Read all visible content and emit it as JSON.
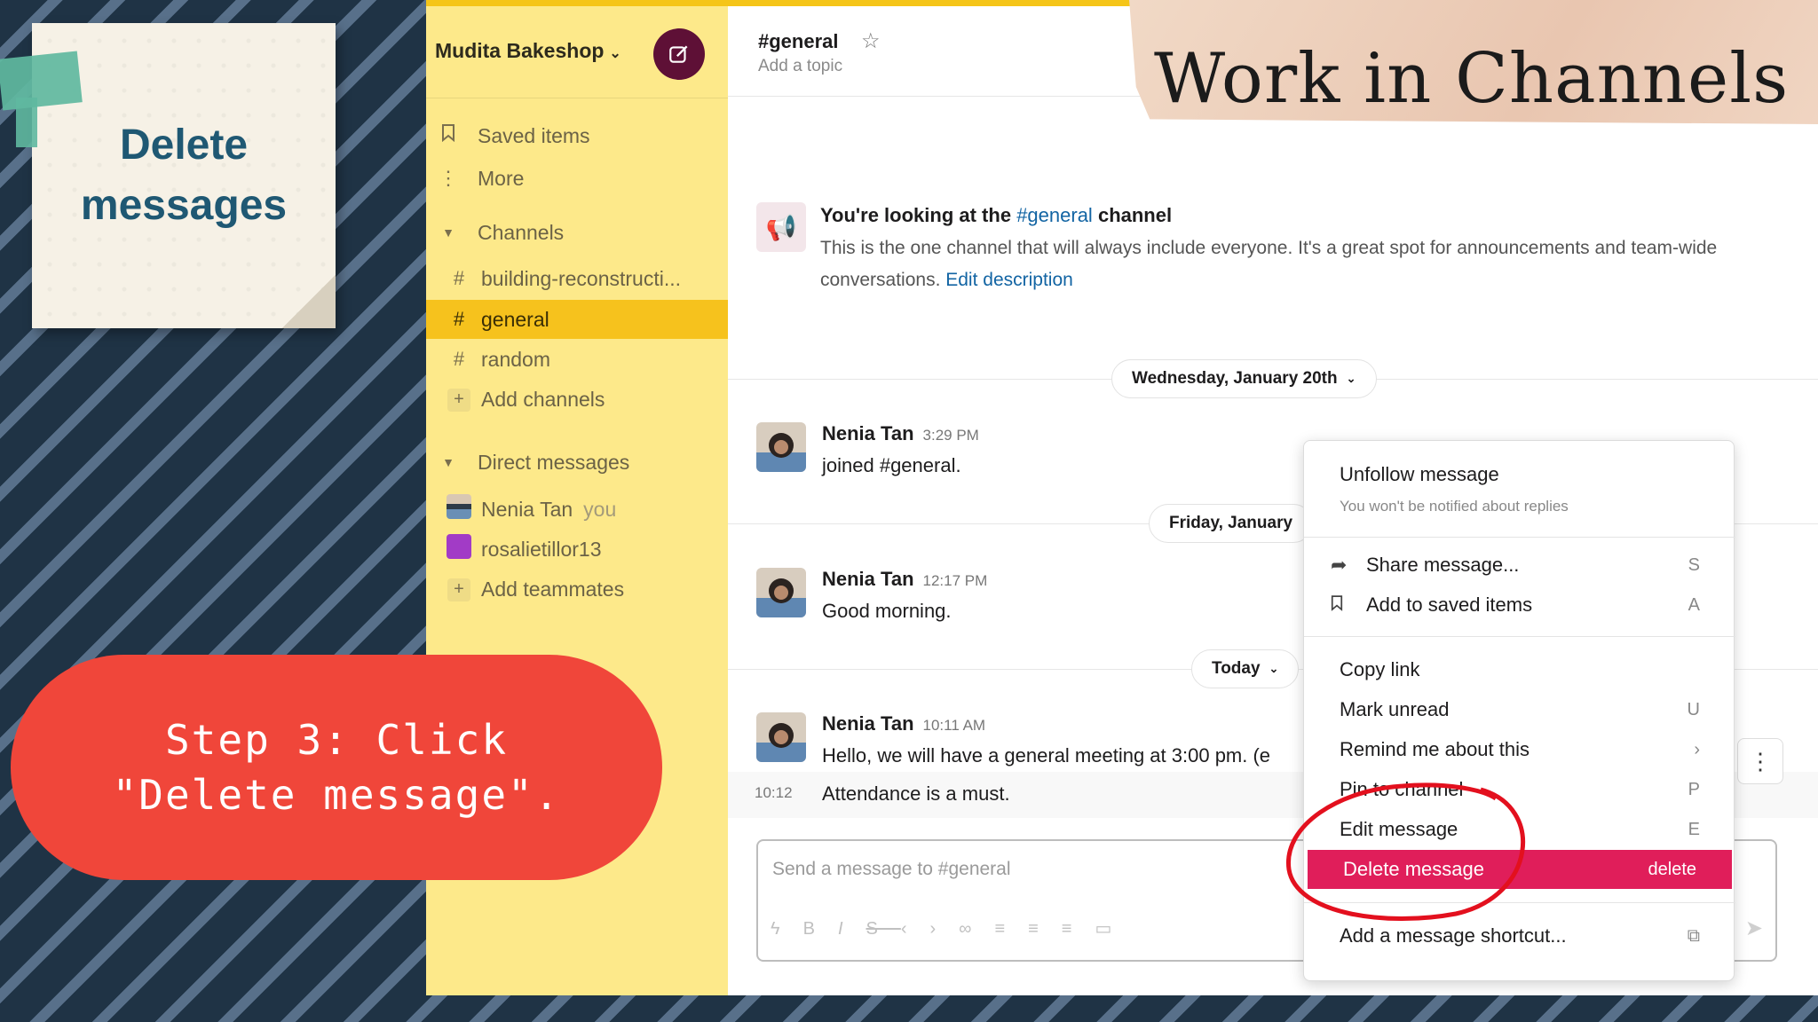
{
  "note": {
    "line1": "Delete",
    "line2": "messages"
  },
  "step": {
    "text": "Step 3: Click \"Delete message\"."
  },
  "banner": {
    "title": "Work in Channels"
  },
  "sidebar": {
    "workspace": "Mudita Bakeshop",
    "items": [
      {
        "label": "Saved items"
      },
      {
        "label": "More"
      }
    ],
    "channels_header": "Channels",
    "channels": [
      {
        "label": "building-reconstructi..."
      },
      {
        "label": "general"
      },
      {
        "label": "random"
      }
    ],
    "add_channels": "Add channels",
    "dm_header": "Direct messages",
    "dms": [
      {
        "label": "Nenia Tan",
        "suffix": "you"
      },
      {
        "label": "rosalietillor13"
      }
    ],
    "add_teammates": "Add teammates"
  },
  "channel": {
    "title": "#general",
    "topic": "Add a topic",
    "intro_prefix": "You're looking at the",
    "intro_channel": "#general",
    "intro_suffix": "channel",
    "intro_desc": "This is the one channel that will always include everyone. It's a great spot for announcements and team-wide conversations.",
    "edit_description": "Edit description"
  },
  "dates": {
    "d1": "Wednesday, January 20th",
    "d2": "Friday, January",
    "d3": "Today"
  },
  "messages": [
    {
      "name": "Nenia Tan",
      "time": "3:29 PM",
      "text": "joined #general."
    },
    {
      "name": "Nenia Tan",
      "time": "12:17 PM",
      "text": "Good morning."
    },
    {
      "name": "Nenia Tan",
      "time": "10:11 AM",
      "text": "Hello, we will have a general meeting at 3:00 pm. (e"
    }
  ],
  "extra_message": {
    "time": "10:12",
    "text": "Attendance is a must."
  },
  "composer": {
    "placeholder": "Send a message to #general"
  },
  "menu": {
    "unfollow": "Unfollow message",
    "unfollow_sub": "You won't be notified about replies",
    "share": "Share message...",
    "share_key": "S",
    "save": "Add to saved items",
    "save_key": "A",
    "copy": "Copy link",
    "mark": "Mark unread",
    "mark_key": "U",
    "remind": "Remind me about this",
    "remind_key": "›",
    "pin": "Pin to channel",
    "pin_key": "P",
    "edit": "Edit message",
    "edit_key": "E",
    "delete": "Delete message",
    "delete_key": "delete",
    "shortcut": "Add a message shortcut..."
  },
  "colors": {
    "accent_delete": "#e01e5a",
    "sidebar_bg": "#fde98a",
    "active_channel": "#f6c21d",
    "step_bg": "#f0463a"
  }
}
